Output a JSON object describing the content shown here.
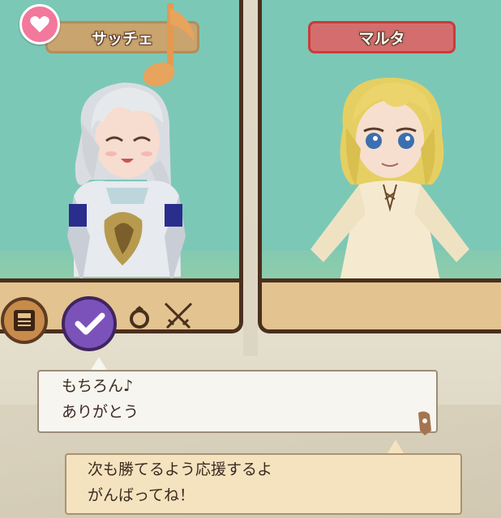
{
  "characters": {
    "left": {
      "name": "サッチェ",
      "affection": "heart-icon"
    },
    "right": {
      "name": "マルタ"
    }
  },
  "action_icons": [
    "journal-icon",
    "check-icon",
    "ring-icon",
    "crossed-swords-icon"
  ],
  "dialogue": {
    "player_line": "もちろん♪\nありがとう",
    "npc_line": "次も勝てるよう応援するよ\nがんばってね！"
  },
  "colors": {
    "panel_bg": "#7cc8b6",
    "panel_border": "#4a2f1e",
    "left_tag": "#c9a46e",
    "right_tag": "#d46e6e",
    "heart": "#f2789c",
    "check_button": "#7b52b9"
  }
}
